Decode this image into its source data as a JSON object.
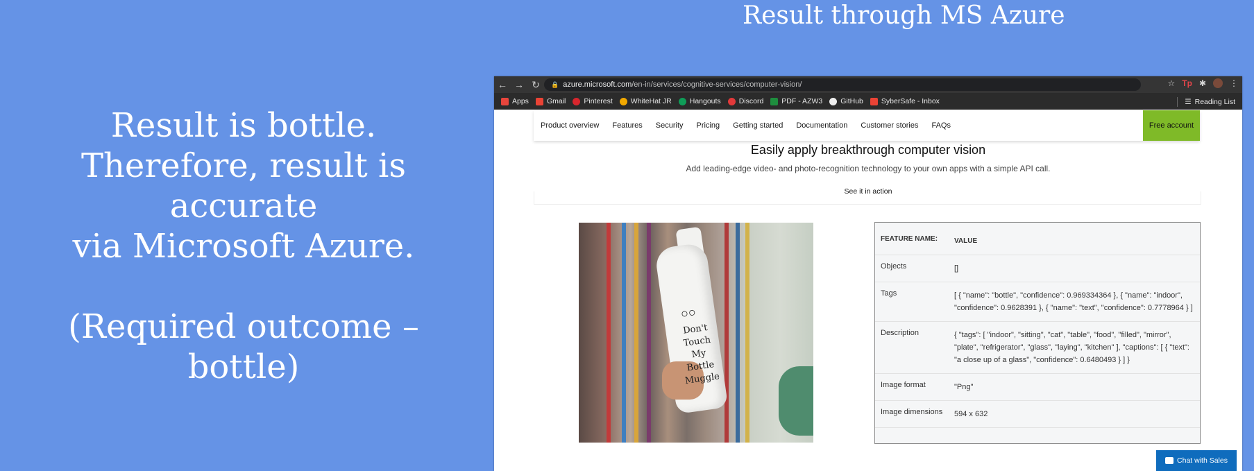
{
  "slide": {
    "title": "Result through MS Azure",
    "left_text": {
      "line1": "Result is bottle.",
      "line2": "Therefore, result is accurate",
      "line3": "via Microsoft Azure.",
      "line4": "(Required outcome –",
      "line5": "bottle)"
    }
  },
  "browser": {
    "url_host": "azure.microsoft.com",
    "url_path": "/en-in/services/cognitive-services/computer-vision/",
    "bookmarks": [
      "Apps",
      "Gmail",
      "Pinterest",
      "WhiteHat JR",
      "Hangouts",
      "Discord",
      "PDF - AZW3",
      "GitHub",
      "SyberSafe - Inbox"
    ],
    "reading_list": "Reading List"
  },
  "site": {
    "nav": [
      "Product overview",
      "Features",
      "Security",
      "Pricing",
      "Getting started",
      "Documentation",
      "Customer stories",
      "FAQs"
    ],
    "free_account": "Free account",
    "hero_title": "Easily apply breakthrough computer vision",
    "hero_sub": "Add leading-edge video- and photo-recognition technology to your own apps with a simple API call.",
    "see_in_action": "See it in action",
    "image_text": "Don't Touch My Bottle Muggle"
  },
  "results": {
    "header_key": "FEATURE NAME:",
    "header_value": "VALUE",
    "rows": [
      {
        "key": "Objects",
        "value": "[]"
      },
      {
        "key": "Tags",
        "value": "[ { \"name\": \"bottle\", \"confidence\": 0.969334364 }, { \"name\": \"indoor\", \"confidence\": 0.9628391 }, { \"name\": \"text\", \"confidence\": 0.7778964 } ]"
      },
      {
        "key": "Description",
        "value": "{ \"tags\": [ \"indoor\", \"sitting\", \"cat\", \"table\", \"food\", \"filled\", \"mirror\", \"plate\", \"refrigerator\", \"glass\", \"laying\", \"kitchen\" ], \"captions\": [ { \"text\": \"a close up of a glass\", \"confidence\": 0.6480493 } ] }"
      },
      {
        "key": "Image format",
        "value": "\"Png\""
      },
      {
        "key": "Image dimensions",
        "value": "594 x 632"
      }
    ]
  },
  "chat": {
    "label": "Chat with Sales"
  },
  "colors": {
    "slide_bg": "#6593e6",
    "free_account_bg": "#7fba28",
    "chat_bg": "#0f6cbd"
  }
}
